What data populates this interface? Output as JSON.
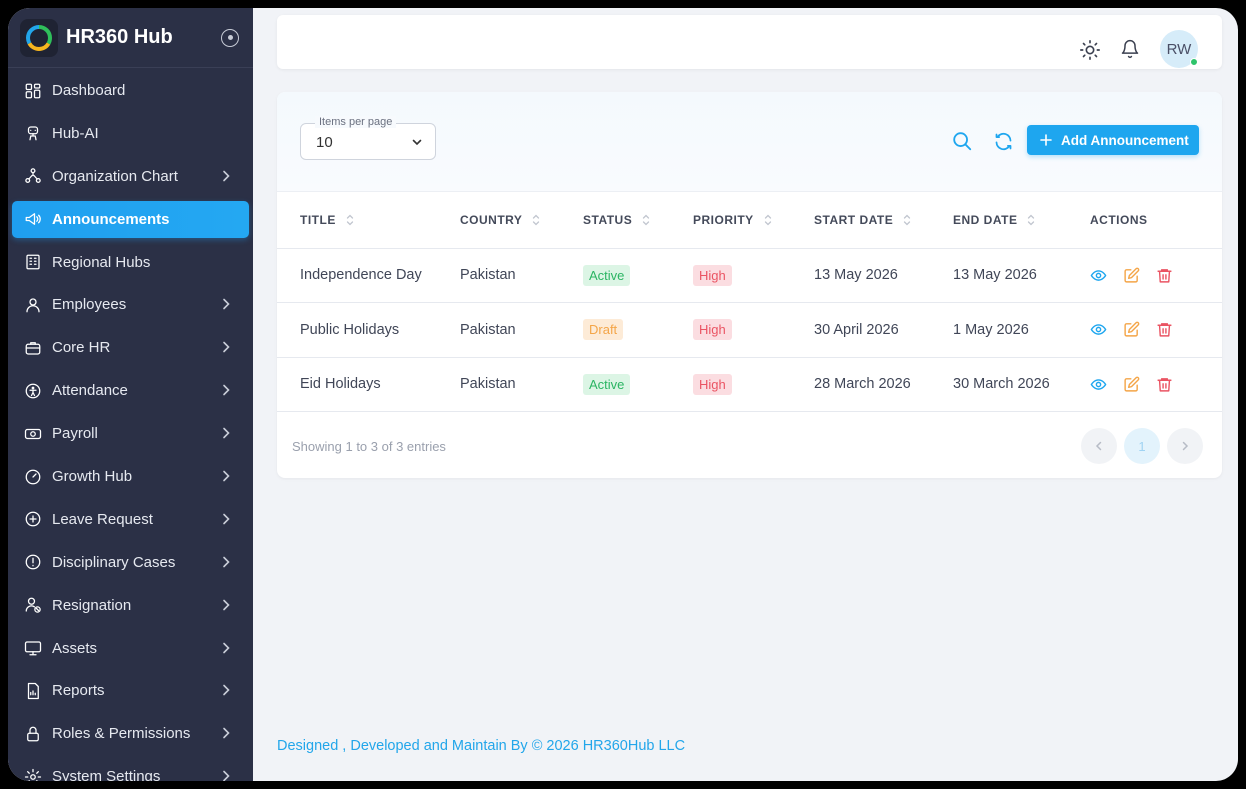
{
  "brand": {
    "name": "HR360 Hub"
  },
  "sidebar": {
    "items": [
      {
        "label": "Dashboard",
        "icon": "dashboard-icon",
        "chevron": false
      },
      {
        "label": "Hub-AI",
        "icon": "robot-icon",
        "chevron": false
      },
      {
        "label": "Organization Chart",
        "icon": "org-chart-icon",
        "chevron": true
      },
      {
        "label": "Announcements",
        "icon": "megaphone-icon",
        "chevron": false,
        "active": true
      },
      {
        "label": "Regional Hubs",
        "icon": "building-icon",
        "chevron": false
      },
      {
        "label": "Employees",
        "icon": "user-icon",
        "chevron": true
      },
      {
        "label": "Core HR",
        "icon": "briefcase-icon",
        "chevron": true
      },
      {
        "label": "Attendance",
        "icon": "accessibility-icon",
        "chevron": true
      },
      {
        "label": "Payroll",
        "icon": "money-icon",
        "chevron": true
      },
      {
        "label": "Growth Hub",
        "icon": "gauge-icon",
        "chevron": true
      },
      {
        "label": "Leave Request",
        "icon": "plus-circle-icon",
        "chevron": true
      },
      {
        "label": "Disciplinary Cases",
        "icon": "alert-circle-icon",
        "chevron": true
      },
      {
        "label": "Resignation",
        "icon": "user-x-icon",
        "chevron": true
      },
      {
        "label": "Assets",
        "icon": "monitor-icon",
        "chevron": true
      },
      {
        "label": "Reports",
        "icon": "report-icon",
        "chevron": true
      },
      {
        "label": "Roles & Permissions",
        "icon": "lock-icon",
        "chevron": true
      },
      {
        "label": "System Settings",
        "icon": "gear-icon",
        "chevron": true
      }
    ]
  },
  "topbar": {
    "avatar_initials": "RW",
    "status": "online"
  },
  "toolbar": {
    "items_per_page_label": "Items per page",
    "items_per_page_value": "10",
    "add_button_label": "Add Announcement"
  },
  "table": {
    "columns": [
      "TITLE",
      "COUNTRY",
      "STATUS",
      "PRIORITY",
      "START DATE",
      "END DATE",
      "ACTIONS"
    ],
    "rows": [
      {
        "title": "Independence Day",
        "country": "Pakistan",
        "status": "Active",
        "priority": "High",
        "start_date": "13 May 2026",
        "end_date": "13 May 2026"
      },
      {
        "title": "Public Holidays",
        "country": "Pakistan",
        "status": "Draft",
        "priority": "High",
        "start_date": "30 April 2026",
        "end_date": "1 May 2026"
      },
      {
        "title": "Eid Holidays",
        "country": "Pakistan",
        "status": "Active",
        "priority": "High",
        "start_date": "28 March 2026",
        "end_date": "30 March 2026"
      }
    ]
  },
  "pagination": {
    "summary": "Showing 1 to 3 of 3 entries",
    "current_page": "1"
  },
  "footer": {
    "text": "Designed , Developed and Maintain By © 2026 HR360Hub LLC"
  },
  "colors": {
    "sidebar_bg": "#2b3046",
    "accent": "#1ea6ef",
    "active_green": "#2bb563",
    "draft_orange": "#f4a548",
    "high_red": "#ea5463"
  }
}
